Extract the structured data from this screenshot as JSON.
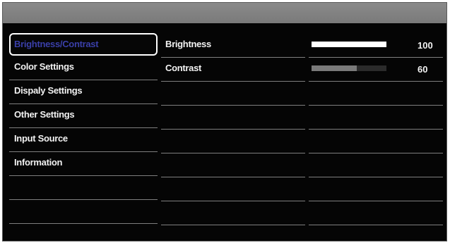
{
  "menu": {
    "items": [
      {
        "label": "Brightness/Contrast",
        "selected": true
      },
      {
        "label": "Color Settings",
        "selected": false
      },
      {
        "label": "Dispaly Settings",
        "selected": false
      },
      {
        "label": "Other Settings",
        "selected": false
      },
      {
        "label": "Input Source",
        "selected": false
      },
      {
        "label": "Information",
        "selected": false
      }
    ]
  },
  "submenu": {
    "items": [
      {
        "label": "Brightness"
      },
      {
        "label": "Contrast"
      }
    ]
  },
  "values": [
    {
      "value": "100",
      "level": 1.0,
      "style": "bright"
    },
    {
      "value": "60",
      "level": 0.6,
      "style": "dim"
    }
  ],
  "colors": {
    "selected_text": "#3a3fa8",
    "header": "#808080",
    "background": "#050505"
  }
}
